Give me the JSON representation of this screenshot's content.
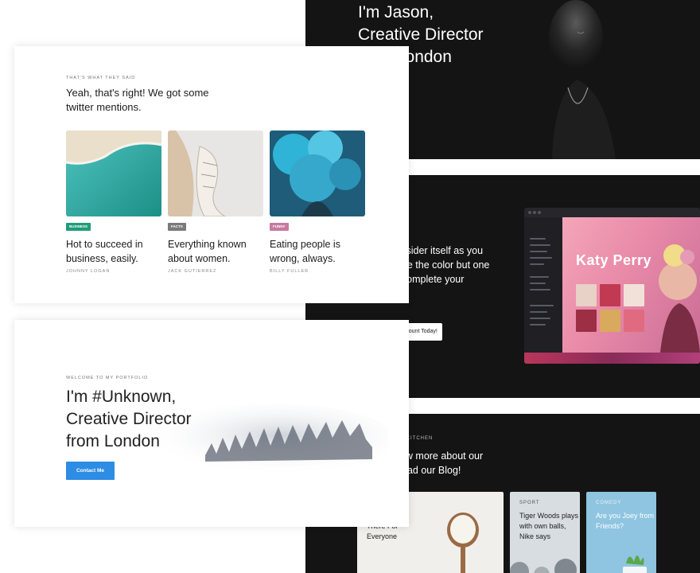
{
  "dark_top": {
    "hero_title": "I'm Jason,\nCreative Director\nfrom London"
  },
  "dark_middle": {
    "body_text": "should consider itself as you might not be the color but one need it to complete your picture.",
    "button_label": "Account Today!",
    "app": {
      "artist_title": "Katy Perry",
      "tiles_colors": [
        "#e8d1c6",
        "#c23a52",
        "#f2e1d8",
        "#9c2f43",
        "#d9a95e",
        "#e06a7f"
      ]
    }
  },
  "dark_bottom": {
    "kicker": "KITCHEN",
    "heading": "now more about our\nRead our Blog!",
    "cards": [
      {
        "kicker": "",
        "title": "The Deal\nout There For\nEveryone"
      },
      {
        "kicker": "SPORT",
        "title": "Tiger Woods\nplays with own\nballs, Nike says"
      },
      {
        "kicker": "COMEDY",
        "title": "Are you Joey\nfrom Friends?"
      }
    ]
  },
  "twitter_card": {
    "kicker": "THAT'S WHAT THEY SAID",
    "title": "Yeah, that's right! We got some\ntwitter mentions.",
    "articles": [
      {
        "badge": "BUSINESS",
        "badge_color": "#1f9c7a",
        "title": "Hot to succeed in\nbusiness, easily.",
        "author": "JOHNNY LOGAN"
      },
      {
        "badge": "FACTS",
        "badge_color": "#7a7a7a",
        "title": "Everything known\nabout women.",
        "author": "JACK GUTIERREZ"
      },
      {
        "badge": "FUNNY",
        "badge_color": "#c77aa1",
        "title": "Eating people is\nwrong, always.",
        "author": "BILLY FULLER"
      }
    ]
  },
  "portfolio_card": {
    "kicker": "WELCOME TO MY PORTFOLIO",
    "title": "I'm #Unknown,\nCreative Director\nfrom London",
    "button_label": "Contact Me",
    "accent_color": "#2d8ce3"
  }
}
